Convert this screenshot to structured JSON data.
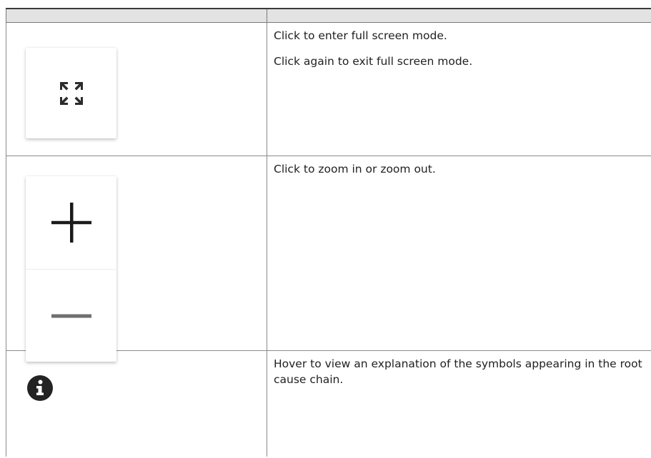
{
  "table": {
    "header": [
      "",
      ""
    ],
    "rows": [
      {
        "icon": "fullscreen-toggle-icon",
        "lines": [
          "Click to enter full screen mode.",
          "Click again to exit full screen mode."
        ]
      },
      {
        "icon": "zoom-in-out-icons",
        "lines": [
          "Click to zoom in or zoom out."
        ]
      },
      {
        "icon": "info-icon",
        "lines": [
          "Hover to view an explanation of the symbols appearing in the root cause chain."
        ]
      }
    ]
  },
  "colors": {
    "header_bg": "#e3e3e3",
    "border": "#8a8a8a",
    "icon_dark": "#2b2b2b",
    "minus_gray": "#6f6f6f",
    "info_bg": "#232323"
  }
}
